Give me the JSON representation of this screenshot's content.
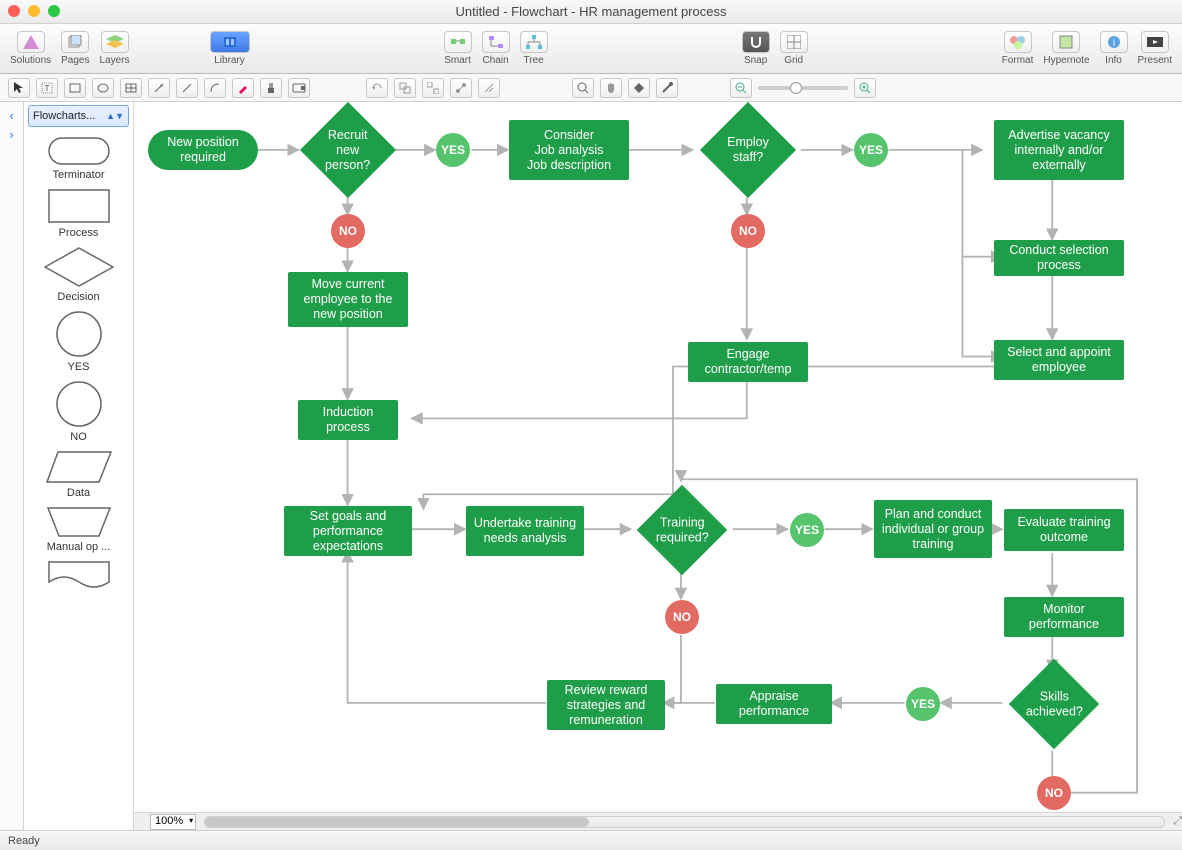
{
  "title": "Untitled - Flowchart - HR management process",
  "traffic_lights": {
    "close": "close",
    "min": "minimize",
    "max": "zoom"
  },
  "toolbar": {
    "solutions": "Solutions",
    "pages": "Pages",
    "layers": "Layers",
    "library": "Library",
    "smart": "Smart",
    "chain": "Chain",
    "tree": "Tree",
    "snap": "Snap",
    "grid": "Grid",
    "format": "Format",
    "hypernote": "Hypernote",
    "info": "Info",
    "present": "Present"
  },
  "sidebar": {
    "selector_label": "Flowcharts...",
    "shapes": [
      {
        "name": "terminator",
        "label": "Terminator"
      },
      {
        "name": "process",
        "label": "Process"
      },
      {
        "name": "decision",
        "label": "Decision"
      },
      {
        "name": "yes",
        "label": "YES"
      },
      {
        "name": "no",
        "label": "NO"
      },
      {
        "name": "data",
        "label": "Data"
      },
      {
        "name": "manual",
        "label": "Manual op ..."
      }
    ]
  },
  "canvas": {
    "zoom": "100%",
    "nodes": {
      "n1": "New position required",
      "n2": "Recruit new person?",
      "y1": "YES",
      "no1": "NO",
      "n3": "Consider\nJob analysis\nJob description",
      "n4": "Employ staff?",
      "y2": "YES",
      "no2": "NO",
      "n5": "Advertise vacancy internally and/or externally",
      "n6": "Conduct selection process",
      "n7": "Select and appoint employee",
      "n8": "Engage contractor/temp",
      "n9": "Move current employee to the new position",
      "n10": "Induction process",
      "n11": "Set goals and performance expectations",
      "n12": "Undertake training needs analysis",
      "n13": "Training required?",
      "y3": "YES",
      "no3": "NO",
      "n14": "Plan and conduct individual or group training",
      "n15": "Evaluate training outcome",
      "n16": "Monitor performance",
      "n17": "Skills achieved?",
      "y4": "YES",
      "no4": "NO",
      "n18": "Appraise performance",
      "n19": "Review reward strategies and remuneration"
    }
  },
  "status": "Ready"
}
